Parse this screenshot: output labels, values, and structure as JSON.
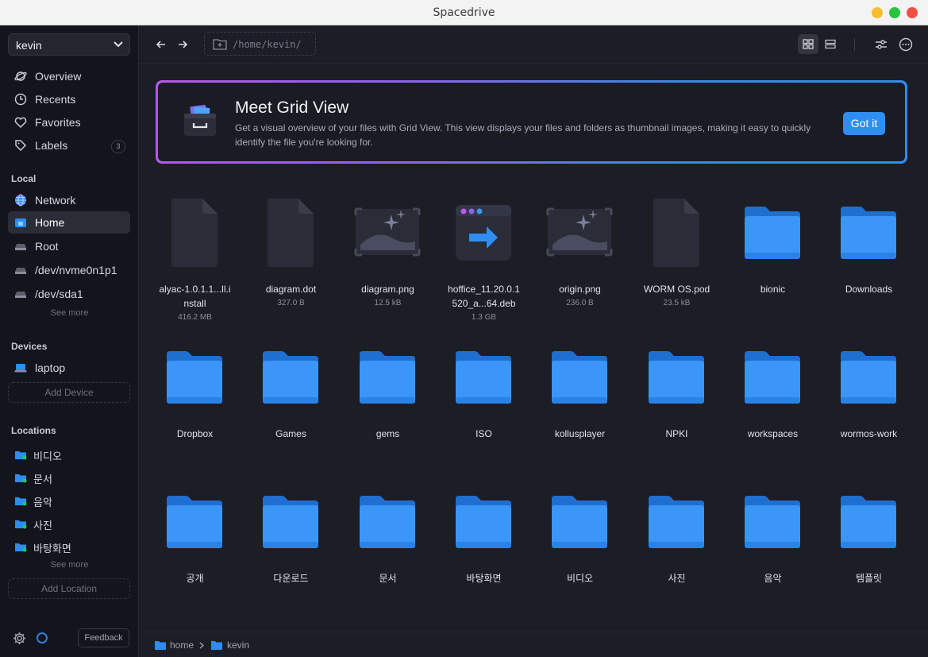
{
  "window": {
    "title": "Spacedrive"
  },
  "sidebar": {
    "library": "kevin",
    "main_items": [
      {
        "label": "Overview",
        "icon": "planet-icon"
      },
      {
        "label": "Recents",
        "icon": "clock-icon"
      },
      {
        "label": "Favorites",
        "icon": "heart-icon"
      },
      {
        "label": "Labels",
        "icon": "tag-icon",
        "badge": "3"
      }
    ],
    "local_title": "Local",
    "local_items": [
      {
        "label": "Network",
        "icon": "globe-icon"
      },
      {
        "label": "Home",
        "icon": "home-drive-icon",
        "active": true
      },
      {
        "label": "Root",
        "icon": "drive-icon"
      },
      {
        "label": "/dev/nvme0n1p1",
        "icon": "drive-icon"
      },
      {
        "label": "/dev/sda1",
        "icon": "drive-icon"
      }
    ],
    "local_see_more": "See more",
    "devices_title": "Devices",
    "devices": [
      {
        "label": "laptop",
        "icon": "laptop-icon"
      }
    ],
    "add_device": "Add Device",
    "locations_title": "Locations",
    "locations": [
      "비디오",
      "문서",
      "음악",
      "사진",
      "바탕화면"
    ],
    "locations_see_more": "See more",
    "add_location": "Add Location",
    "feedback": "Feedback"
  },
  "topbar": {
    "path": "/home/kevin/"
  },
  "banner": {
    "title": "Meet Grid View",
    "description": "Get a visual overview of your files with Grid View. This view displays your files and folders as thumbnail images, making it easy to quickly identify the file you're looking for.",
    "button": "Got it"
  },
  "files": [
    {
      "name": "alyac-1.0.1.1...ll.install",
      "size": "416.2 MB",
      "kind": "doc"
    },
    {
      "name": "diagram.dot",
      "size": "327.0 B",
      "kind": "doc"
    },
    {
      "name": "diagram.png",
      "size": "12.5 kB",
      "kind": "image"
    },
    {
      "name": "hoffice_11.20.0.1520_a...64.deb",
      "size": "1.3 GB",
      "kind": "app"
    },
    {
      "name": "origin.png",
      "size": "236.0 B",
      "kind": "image"
    },
    {
      "name": "WORM OS.pod",
      "size": "23.5 kB",
      "kind": "doc"
    },
    {
      "name": "bionic",
      "size": "",
      "kind": "folder"
    },
    {
      "name": "Downloads",
      "size": "",
      "kind": "folder"
    },
    {
      "name": "Dropbox",
      "size": "",
      "kind": "folder"
    },
    {
      "name": "Games",
      "size": "",
      "kind": "folder"
    },
    {
      "name": "gems",
      "size": "",
      "kind": "folder"
    },
    {
      "name": "ISO",
      "size": "",
      "kind": "folder"
    },
    {
      "name": "kollusplayer",
      "size": "",
      "kind": "folder"
    },
    {
      "name": "NPKI",
      "size": "",
      "kind": "folder"
    },
    {
      "name": "workspaces",
      "size": "",
      "kind": "folder"
    },
    {
      "name": "wormos-work",
      "size": "",
      "kind": "folder"
    },
    {
      "name": "공개",
      "size": "",
      "kind": "folder"
    },
    {
      "name": "다운로드",
      "size": "",
      "kind": "folder"
    },
    {
      "name": "문서",
      "size": "",
      "kind": "folder"
    },
    {
      "name": "바탕화면",
      "size": "",
      "kind": "folder"
    },
    {
      "name": "비디오",
      "size": "",
      "kind": "folder"
    },
    {
      "name": "사진",
      "size": "",
      "kind": "folder"
    },
    {
      "name": "음악",
      "size": "",
      "kind": "folder"
    },
    {
      "name": "템플릿",
      "size": "",
      "kind": "folder"
    }
  ],
  "breadcrumb": [
    "home",
    "kevin"
  ],
  "colors": {
    "accent": "#2f8ef2",
    "folder": "#2d8cf2",
    "sidebar_bg": "#14151c",
    "main_bg": "#1c1d25"
  }
}
